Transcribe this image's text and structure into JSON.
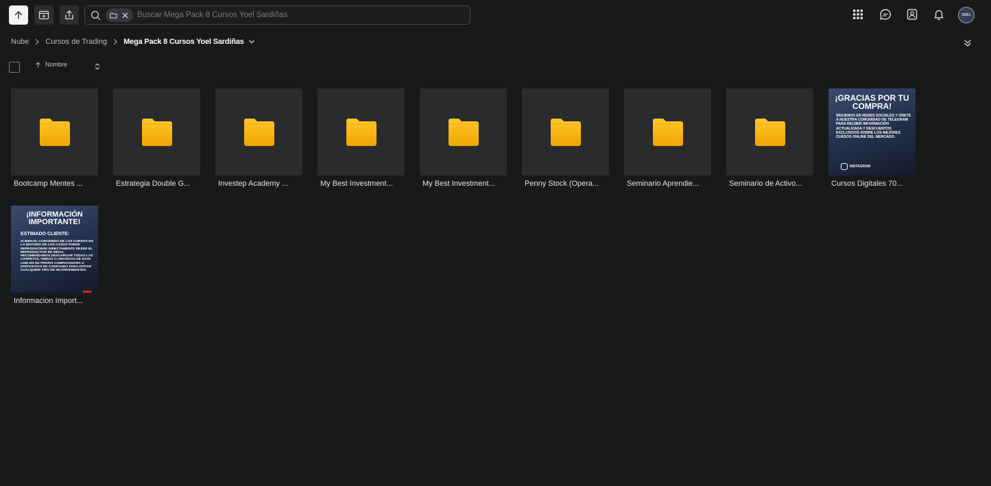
{
  "toolbar": {
    "upload_icon": "arrow-up-icon",
    "new_folder_icon": "folder-plus-icon",
    "share_icon": "share-icon"
  },
  "search": {
    "placeholder": "Buscar Mega Pack 8 Cursos Yoel Sardiñas",
    "value": "",
    "filter_chip_icon": "folder-icon"
  },
  "header_right": {
    "icons": [
      "apps-grid-icon",
      "chat-icon",
      "contacts-icon",
      "bell-icon"
    ],
    "avatar_text": "SDEL"
  },
  "breadcrumb": {
    "items": [
      "Nube",
      "Cursos de Trading"
    ],
    "current": "Mega Pack 8 Cursos Yoel Sardiñas"
  },
  "sort": {
    "label": "Nombre",
    "direction": "ascending"
  },
  "colors": {
    "background": "#181919",
    "tile": "#2a2b2c",
    "folder": "#f7b500"
  },
  "files": [
    {
      "name": "Bootcamp Mentes ...",
      "type": "folder"
    },
    {
      "name": "Estrategia Double G...",
      "type": "folder"
    },
    {
      "name": "Investep Academy ...",
      "type": "folder"
    },
    {
      "name": "My Best Investment...",
      "type": "folder"
    },
    {
      "name": "My Best Investment...",
      "type": "folder"
    },
    {
      "name": "Penny Stock (Opera...",
      "type": "folder"
    },
    {
      "name": "Seminario Aprendie...",
      "type": "folder"
    },
    {
      "name": "Seminario de Activo...",
      "type": "folder"
    },
    {
      "name": "Cursos Digitales 70...",
      "type": "image"
    },
    {
      "name": "Informacion Import...",
      "type": "image"
    }
  ],
  "poster1": {
    "title": "¡GRACIAS POR TU COMPRA!",
    "text": "SÍGUENOS EN REDES SOCIALES Y ÚNETE A NUESTRA COMUNIDAD DE TELEGRAM PARA RECIBIR INFORMACIÓN ACTUALIZADA Y DESCUENTOS EXCLUSIVOS SOBRE LOS MEJORES CURSOS ONLINE DEL MERCADO.",
    "social": "INSTAGRAM"
  },
  "poster2": {
    "title": "¡INFORMACIÓN IMPORTANTE!",
    "subtitle": "ESTIMADO CLIENTE:",
    "text": "SI BIEN EL CONTENIDO DE LOS CURSOS EN LA MAYORÍA DE LOS CASOS PUEDE REPRODUCIRSE DIRECTAMENTE DESDE EL REPRODUCTOR DE MEGA, RECOMENDAMOS DESCARGAR TODAS LAS CARPETAS, VIDEOS O ARCHIVOS DE ESTE LINK EN SU PROPIA COMPUTADORA O DISPOSITIVO DE CONFIANZA PARA EVITAR CUALQUIER TIPO DE INCONVENIENTES."
  }
}
